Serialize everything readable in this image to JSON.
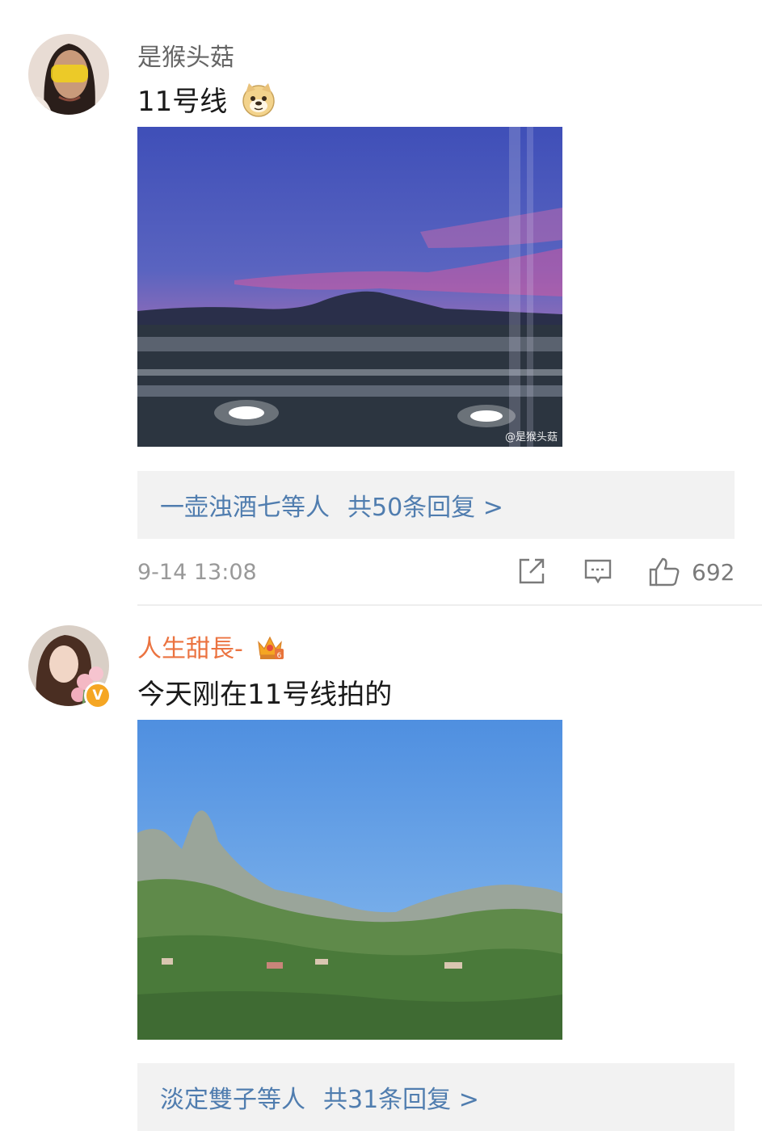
{
  "comments": [
    {
      "username": "是猴头菇",
      "text": "11号线",
      "emoji": "doge-emoji",
      "watermark": "@是猴头菇",
      "replies": {
        "names": "一壶浊酒七等人",
        "summary": "共50条回复 >"
      },
      "timestamp": "9-14 13:08",
      "likes": "692",
      "verified": false
    },
    {
      "username": "人生甜長-",
      "badge": "crown-badge-icon",
      "text": "今天刚在11号线拍的",
      "replies": {
        "names": "淡定雙子等人",
        "summary": "共31条回复 >"
      },
      "verified": true,
      "verified_mark": "V"
    }
  ],
  "colors": {
    "username": "#666666",
    "vip_username": "#eb7340",
    "link_blue": "#507daf",
    "reply_bg": "#f2f2f2",
    "meta_gray": "#999999"
  }
}
